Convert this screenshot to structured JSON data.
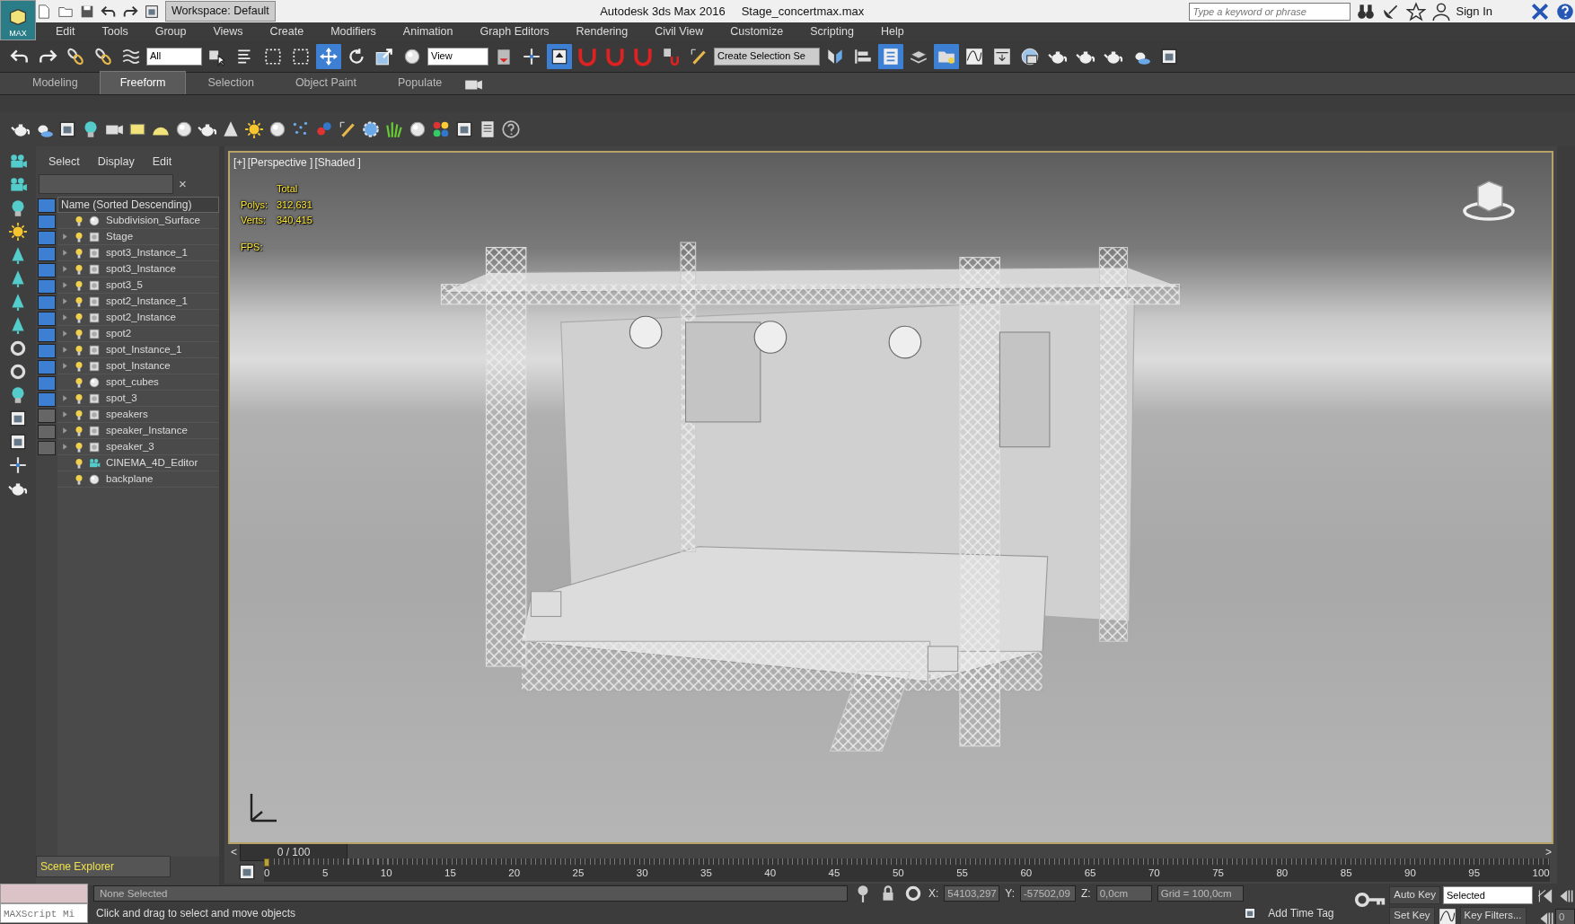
{
  "title_bar": {
    "logo": "MAX",
    "workspace": "Workspace: Default",
    "app_title": "Autodesk 3ds Max 2016",
    "file_name": "Stage_concertmax.max",
    "search": {
      "placeholder": "Type a keyword or phrase"
    },
    "sign_in": "Sign In"
  },
  "menu": [
    "Edit",
    "Tools",
    "Group",
    "Views",
    "Create",
    "Modifiers",
    "Animation",
    "Graph Editors",
    "Rendering",
    "Civil View",
    "Customize",
    "Scripting",
    "Help"
  ],
  "main_toolbar": {
    "filter": "All",
    "coord_system": "View",
    "selection_set": "Create Selection Se",
    "buttons": [
      {
        "selected": false
      },
      {
        "selected": false
      },
      {
        "selected": false
      },
      {
        "selected": false
      },
      {
        "selected": false
      },
      {
        "selected": false
      },
      {
        "selected": false
      },
      {
        "selected": false
      },
      {
        "selected": false
      },
      {
        "selected": true
      },
      {
        "selected": false
      },
      {
        "selected": false
      },
      {
        "selected": false
      },
      {
        "selected": false
      },
      {
        "selected": false
      },
      {
        "selected": true
      },
      {
        "selected": false
      },
      {
        "selected": false
      },
      {
        "selected": false
      },
      {
        "selected": false
      },
      {
        "selected": false
      },
      {
        "selected": false
      },
      {
        "selected": false
      },
      {
        "selected": true
      },
      {
        "selected": false
      },
      {
        "selected": true
      },
      {
        "selected": false
      },
      {
        "selected": false
      },
      {
        "selected": false
      },
      {
        "selected": false
      },
      {
        "selected": false
      },
      {
        "selected": false
      },
      {
        "selected": false
      },
      {
        "selected": false
      }
    ]
  },
  "ribbon_tabs": [
    {
      "label": "Modeling",
      "selected": false
    },
    {
      "label": "Freeform",
      "selected": true
    },
    {
      "label": "Selection",
      "selected": false
    },
    {
      "label": "Object Paint",
      "selected": false
    },
    {
      "label": "Populate",
      "selected": false
    }
  ],
  "scene_explorer": {
    "menu": [
      "Select",
      "Display",
      "Edit"
    ],
    "column": "Name (Sorted Descending)",
    "filters": [
      {
        "on": true
      },
      {
        "on": true
      },
      {
        "on": true
      },
      {
        "on": true
      },
      {
        "on": true
      },
      {
        "on": true
      },
      {
        "on": true
      },
      {
        "on": true
      },
      {
        "on": true
      },
      {
        "on": true
      },
      {
        "on": true
      },
      {
        "on": true
      },
      {
        "on": true
      },
      {
        "on": false
      },
      {
        "on": false
      },
      {
        "on": false
      }
    ],
    "items": [
      {
        "name": "Subdivision_Surface",
        "kind": "sphere",
        "has_children": false
      },
      {
        "name": "Stage",
        "kind": "object",
        "has_children": true
      },
      {
        "name": "spot3_Instance_1",
        "kind": "object",
        "has_children": true
      },
      {
        "name": "spot3_Instance",
        "kind": "object",
        "has_children": true
      },
      {
        "name": "spot3_5",
        "kind": "object",
        "has_children": true
      },
      {
        "name": "spot2_Instance_1",
        "kind": "object",
        "has_children": true
      },
      {
        "name": "spot2_Instance",
        "kind": "object",
        "has_children": true
      },
      {
        "name": "spot2",
        "kind": "object",
        "has_children": true
      },
      {
        "name": "spot_Instance_1",
        "kind": "object",
        "has_children": true
      },
      {
        "name": "spot_Instance",
        "kind": "object",
        "has_children": true
      },
      {
        "name": "spot_cubes",
        "kind": "sphere",
        "has_children": false
      },
      {
        "name": "spot_3",
        "kind": "object",
        "has_children": true
      },
      {
        "name": "speakers",
        "kind": "object",
        "has_children": true
      },
      {
        "name": "speaker_Instance",
        "kind": "object",
        "has_children": true
      },
      {
        "name": "speaker_3",
        "kind": "object",
        "has_children": true
      },
      {
        "name": "CINEMA_4D_Editor",
        "kind": "camera",
        "has_children": false
      },
      {
        "name": "backplane",
        "kind": "sphere",
        "has_children": false
      }
    ],
    "dropdown": "Scene Explorer",
    "clear_button": "×"
  },
  "viewport": {
    "labels": [
      "[+]",
      "[Perspective ]",
      "[Shaded ]"
    ],
    "stats": {
      "heading": "Total",
      "rows": [
        {
          "label": "Polys:",
          "value": "312,631"
        },
        {
          "label": "Verts:",
          "value": "340,415"
        }
      ],
      "fps": "FPS:"
    }
  },
  "timeline": {
    "prev": "<",
    "position": "0 / 100",
    "level": 0,
    "next": ">",
    "ticks": [
      "0",
      "5",
      "10",
      "15",
      "20",
      "25",
      "30",
      "35",
      "40",
      "45",
      "50",
      "55",
      "60",
      "65",
      "70",
      "75",
      "80",
      "85",
      "90",
      "95",
      "100"
    ]
  },
  "status_bar": {
    "listener": "MAXScript Mi",
    "selection": "None Selected",
    "prompt": "Click and drag to select and move objects",
    "coords": [
      {
        "axis": "X:",
        "value": "54103,297"
      },
      {
        "axis": "Y:",
        "value": "-57502,09"
      },
      {
        "axis": "Z:",
        "value": "0,0cm"
      }
    ],
    "grid": "Grid = 100,0cm",
    "time_tag": "Add Time Tag",
    "auto_key": "Auto Key",
    "key_mode": "Selected",
    "set_key": "Set Key",
    "key_filters": "Key Filters...",
    "frame": "0"
  }
}
